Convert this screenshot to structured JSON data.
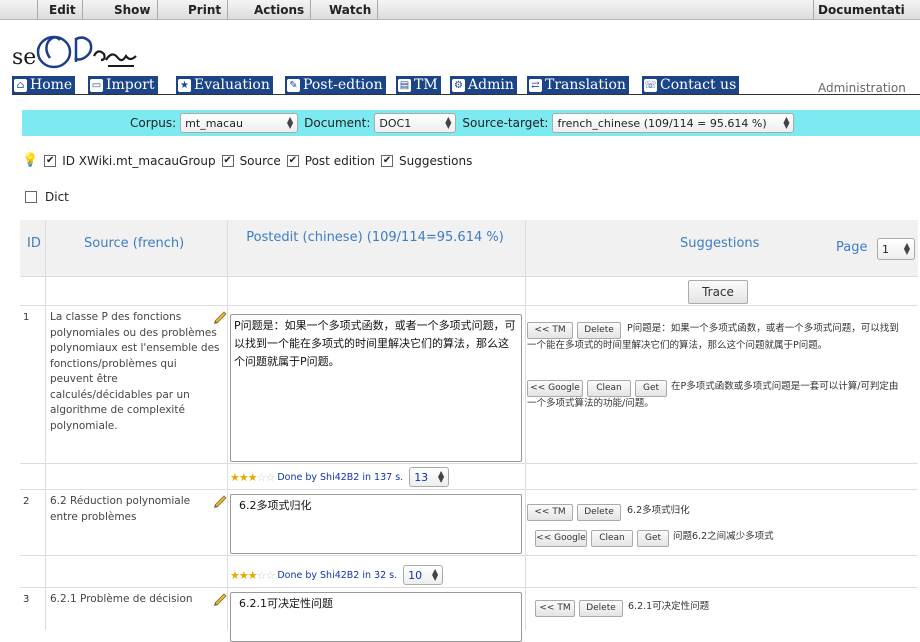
{
  "menu": {
    "items": [
      "Edit",
      "Show",
      "Print",
      "Actions",
      "Watch"
    ],
    "documentation": "Documentati"
  },
  "logo": {
    "text": "seCTra_w"
  },
  "nav": {
    "items": [
      {
        "label": "Home",
        "icon": "home-icon"
      },
      {
        "label": "Import",
        "icon": "folder-icon"
      },
      {
        "label": "Evaluation",
        "icon": "star-icon"
      },
      {
        "label": "Post-edtion",
        "icon": "pencil-icon"
      },
      {
        "label": "TM",
        "icon": "database-icon"
      },
      {
        "label": "Admin",
        "icon": "admin-icon"
      },
      {
        "label": "Translation",
        "icon": "translate-icon"
      },
      {
        "label": "Contact us",
        "icon": "contact-icon"
      }
    ],
    "administration": "Administration"
  },
  "filters": {
    "corpus_label": "Corpus:",
    "corpus_value": "mt_macau",
    "document_label": "Document:",
    "document_value": "DOC1",
    "source_target_label": "Source-target:",
    "source_target_value": "french_chinese (109/114 = 95.614 %)"
  },
  "options": {
    "id_label": "ID XWiki.mt_macauGroup",
    "id_checked": true,
    "source_label": "Source",
    "source_checked": true,
    "post_edition_label": "Post edition",
    "post_edition_checked": true,
    "suggestions_label": "Suggestions",
    "suggestions_checked": true,
    "dict_label": "Dict",
    "dict_checked": false
  },
  "table": {
    "headers": {
      "id": "ID",
      "source": "Source (french)",
      "postedit": "Postedit (chinese) (109/114=95.614 %)",
      "suggestions": "Suggestions",
      "page_label": "Page",
      "page_value": "1"
    },
    "trace_label": "Trace",
    "buttons": {
      "tm": "<< TM",
      "delete": "Delete",
      "google": "<< Google",
      "clean": "Clean",
      "get": "Get"
    },
    "rows": [
      {
        "id": "1",
        "source": "La classe P des fonctions polynomiales ou des problèmes polynomiaux est l'ensemble des fonctions/problèmes qui peuvent être calculés/décidables par un algorithme de complexité polynomiale.",
        "postedit": "P问题是：如果一个多项式函数，或者一个多项式问题，可以找到一个能在多项式的时间里解决它们的算法，那么这个问题就属于P问题。",
        "tm_text": "P问题是：如果一个多项式函数，或者一个多项式问题，可以找到一个能在多项式的时间里解决它们的算法，那么这个问题就属于P问题。",
        "google_text": "在P多项式函数或多项式问题是一套可以计算/可判定由一个多项式算法的功能/问题。",
        "rating": 3,
        "done_text": "Done by Shi42B2 in 137 s.",
        "score": "13"
      },
      {
        "id": "2",
        "source": "6.2 Réduction polynomiale entre problèmes",
        "postedit": "6.2多项式归化",
        "tm_text": "6.2多项式归化",
        "google_text": "问题6.2之间减少多项式",
        "rating": 3,
        "done_text": "Done by Shi42B2 in 32 s.",
        "score": "10"
      },
      {
        "id": "3",
        "source": "6.2.1 Problème de décision",
        "postedit": "6.2.1可决定性问题",
        "tm_text": "6.2.1可决定性问题"
      }
    ]
  }
}
